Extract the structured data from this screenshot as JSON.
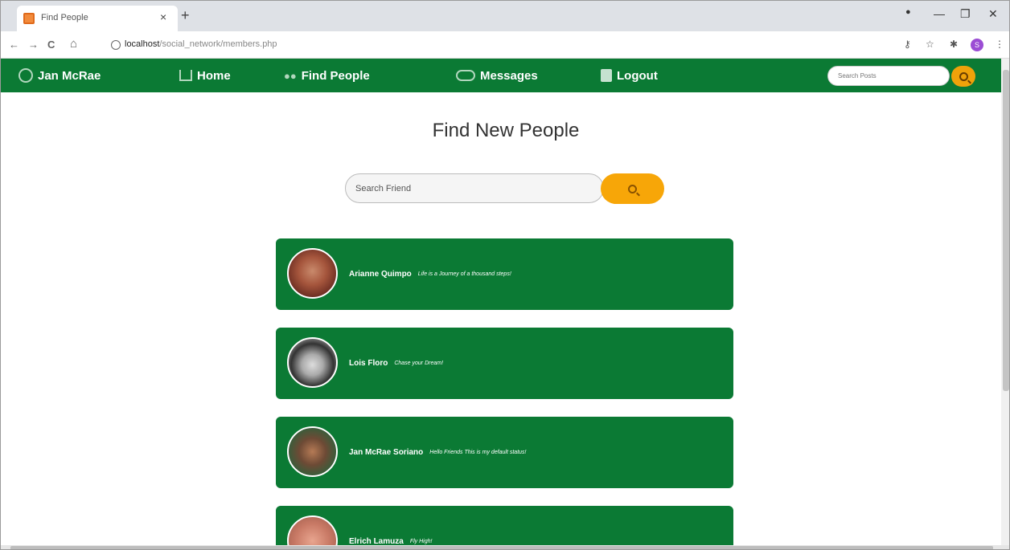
{
  "browser": {
    "tab_title": "Find People",
    "tab_close": "×",
    "new_tab": "+",
    "url_host": "localhost",
    "url_path": "/social_network/members.php",
    "back": "←",
    "forward": "→",
    "reload": "C",
    "home": "⌂",
    "key": "⚷",
    "star": "☆",
    "puzzle": "✱",
    "profile_initial": "S",
    "menu": "⋮",
    "record": "●",
    "minimize": "—",
    "restore": "❐",
    "close": "✕"
  },
  "navbar": {
    "user_name": "Jan McRae",
    "home": "Home",
    "find_people": "Find People",
    "messages": "Messages",
    "logout": "Logout",
    "search_placeholder": "Search Posts",
    "bg_color": "#0b7a34",
    "accent_color": "#f0a20a"
  },
  "page": {
    "title": "Find New People",
    "friend_search_placeholder": "Search Friend"
  },
  "people": [
    {
      "name": "Arianne Quimpo",
      "status": "Life is a Journey of a thousand steps!"
    },
    {
      "name": "Lois Floro",
      "status": "Chase your Dream!"
    },
    {
      "name": "Jan McRae Soriano",
      "status": "Hello Friends This is my default status!"
    },
    {
      "name": "Elrich Lamuza",
      "status": "Fly High!"
    }
  ]
}
